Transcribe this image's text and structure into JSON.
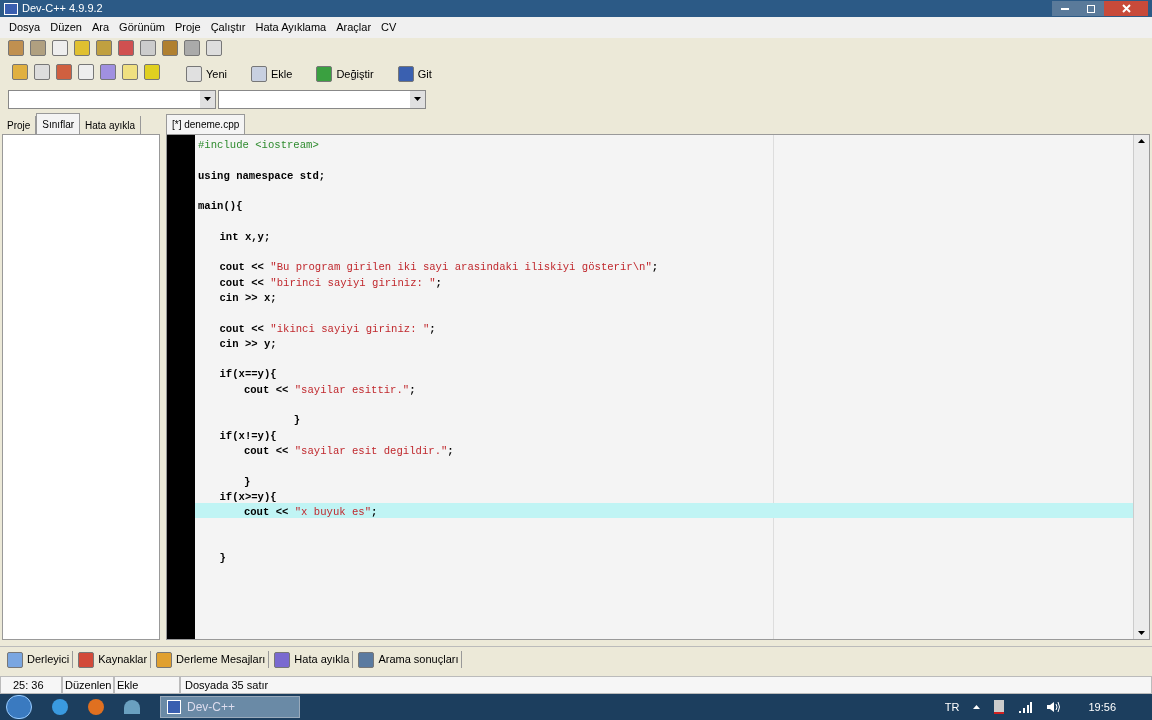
{
  "window": {
    "title": "Dev-C++ 4.9.9.2"
  },
  "menu": [
    "Dosya",
    "Düzen",
    "Ara",
    "Görünüm",
    "Proje",
    "Çalıştır",
    "Hata Ayıklama",
    "Araçlar",
    "CV"
  ],
  "toolbar2": [
    "Yeni",
    "Ekle",
    "Değiştir",
    "Git"
  ],
  "left_tabs": [
    {
      "label": "Proje",
      "selected": false
    },
    {
      "label": "Sınıflar",
      "selected": true
    },
    {
      "label": "Hata ayıkla",
      "selected": false
    }
  ],
  "editor_tabs": [
    {
      "label": "[*] deneme.cpp",
      "selected": true
    }
  ],
  "code": [
    {
      "current": false,
      "segments": [
        {
          "kind": "preproc",
          "text": "#include <iostream>"
        }
      ]
    },
    {
      "current": false
    },
    {
      "current": false,
      "segments": [
        {
          "kind": "code",
          "text": "using namespace std;"
        }
      ]
    },
    {
      "current": false
    },
    {
      "current": false,
      "segments": [
        {
          "kind": "code",
          "text": "main(){"
        }
      ]
    },
    {
      "current": false
    },
    {
      "current": false,
      "segments": [
        {
          "kind": "code",
          "text": "\tint x,y;"
        }
      ]
    },
    {
      "current": false
    },
    {
      "current": false,
      "segments": [
        {
          "kind": "code",
          "text": "\tcout << "
        },
        {
          "kind": "string",
          "text": "\"Bu program girilen iki sayi arasindaki iliskiyi gösterir\\n\""
        },
        {
          "kind": "code",
          "text": ";"
        }
      ]
    },
    {
      "current": false,
      "segments": [
        {
          "kind": "code",
          "text": "\tcout << "
        },
        {
          "kind": "string",
          "text": "\"birinci sayiyi giriniz: \""
        },
        {
          "kind": "code",
          "text": ";"
        }
      ]
    },
    {
      "current": false,
      "segments": [
        {
          "kind": "code",
          "text": "\tcin >> x;"
        }
      ]
    },
    {
      "current": false
    },
    {
      "current": false,
      "segments": [
        {
          "kind": "code",
          "text": "\tcout << "
        },
        {
          "kind": "string",
          "text": "\"ikinci sayiyi giriniz: \""
        },
        {
          "kind": "code",
          "text": ";"
        }
      ]
    },
    {
      "current": false,
      "segments": [
        {
          "kind": "code",
          "text": "\tcin >> y;"
        }
      ]
    },
    {
      "current": false
    },
    {
      "current": false,
      "segments": [
        {
          "kind": "code",
          "text": "\tif(x==y){"
        }
      ]
    },
    {
      "current": false,
      "segments": [
        {
          "kind": "code",
          "text": "\t\tcout << "
        },
        {
          "kind": "string",
          "text": "\"sayilar esittir.\""
        },
        {
          "kind": "code",
          "text": ";"
        }
      ]
    },
    {
      "current": false
    },
    {
      "current": false,
      "segments": [
        {
          "kind": "code",
          "text": "\t\t\t    }"
        }
      ]
    },
    {
      "current": false,
      "segments": [
        {
          "kind": "code",
          "text": "\tif(x!=y){"
        }
      ]
    },
    {
      "current": false,
      "segments": [
        {
          "kind": "code",
          "text": "\t\tcout << "
        },
        {
          "kind": "string",
          "text": "\"sayilar esit degildir.\""
        },
        {
          "kind": "code",
          "text": ";"
        }
      ]
    },
    {
      "current": false
    },
    {
      "current": false,
      "segments": [
        {
          "kind": "code",
          "text": "\t\t}"
        }
      ]
    },
    {
      "current": false,
      "segments": [
        {
          "kind": "code",
          "text": "\tif(x>=y){"
        }
      ]
    },
    {
      "current": true,
      "segments": [
        {
          "kind": "code",
          "text": "\t\tcout << "
        },
        {
          "kind": "string",
          "text": "\"x buyuk es\""
        },
        {
          "kind": "code",
          "text": ";"
        }
      ]
    },
    {
      "current": false
    },
    {
      "current": false
    },
    {
      "current": false,
      "segments": [
        {
          "kind": "code",
          "text": "\t}"
        }
      ]
    }
  ],
  "bottom_tabs": [
    "Derleyici",
    "Kaynaklar",
    "Derleme Mesajları",
    "Hata ayıkla",
    "Arama sonuçları"
  ],
  "status_bar": [
    "25: 36",
    "Düzenlen",
    "Ekle",
    "Dosyada 35 satır"
  ],
  "taskbar": {
    "window_button": "Dev-C++",
    "language": "TR",
    "clock": "19:56"
  }
}
